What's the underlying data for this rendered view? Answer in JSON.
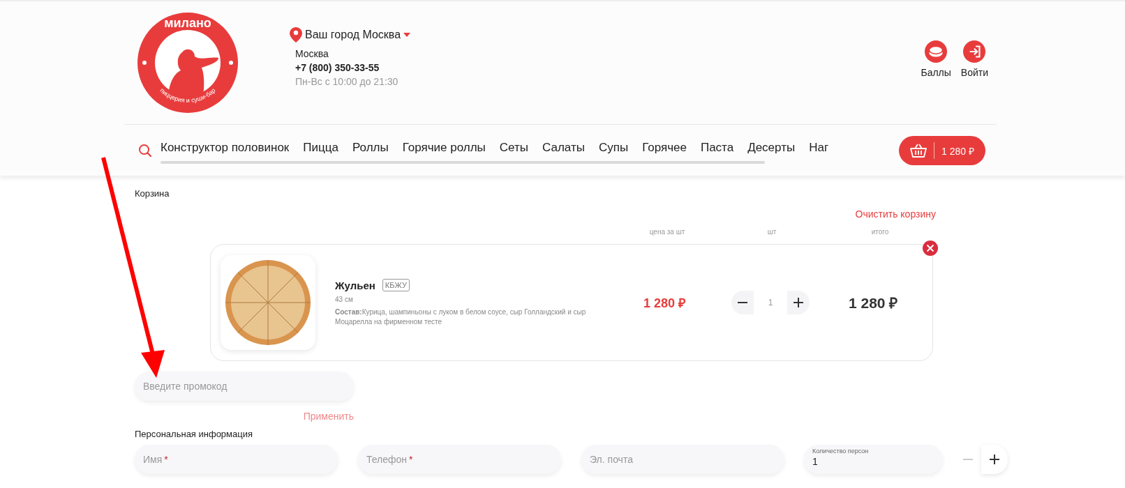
{
  "header": {
    "logo": {
      "title": "милано",
      "subtitle": "пиццерия и суши-бар"
    },
    "city": {
      "label": "Ваш город Москва",
      "name": "Москва",
      "phone": "+7 (800) 350-33-55",
      "hours": "Пн-Вс с 10:00 до 21:30"
    },
    "actions": [
      {
        "kind": "points",
        "label": "Баллы"
      },
      {
        "kind": "login",
        "label": "Войти"
      }
    ]
  },
  "nav": {
    "items": [
      "Конструктор половинок",
      "Пицца",
      "Роллы",
      "Горячие роллы",
      "Сеты",
      "Салаты",
      "Супы",
      "Горячее",
      "Паста",
      "Десерты",
      "Наг"
    ],
    "cart_total": "1 280 ₽"
  },
  "cart": {
    "title": "Корзина",
    "clear": "Очистить корзину",
    "columns": [
      "цена за шт",
      "шт",
      "итого"
    ],
    "items": [
      {
        "name": "Жульен",
        "nutrition_button": "КБЖУ",
        "size": "43 см",
        "composition": "**Состав:**Курица, шампиньоны с луком в белом соусе, сыр Голландский и сыр Моцарелла на фирменном тесте",
        "price": "1 280 ₽",
        "quantity": "1",
        "total": "1 280 ₽"
      }
    ],
    "promo": {
      "placeholder": "Введите промокод",
      "apply": "Применить"
    }
  },
  "personal": {
    "title": "Персональная информация",
    "fields": [
      {
        "placeholder": "Имя",
        "required": true,
        "required_mark": "*"
      },
      {
        "placeholder": "Телефон",
        "required": true,
        "required_mark": "*"
      },
      {
        "placeholder": "Эл. почта",
        "required": false
      }
    ],
    "persons": {
      "label": "Количество персон",
      "value": "1"
    }
  }
}
